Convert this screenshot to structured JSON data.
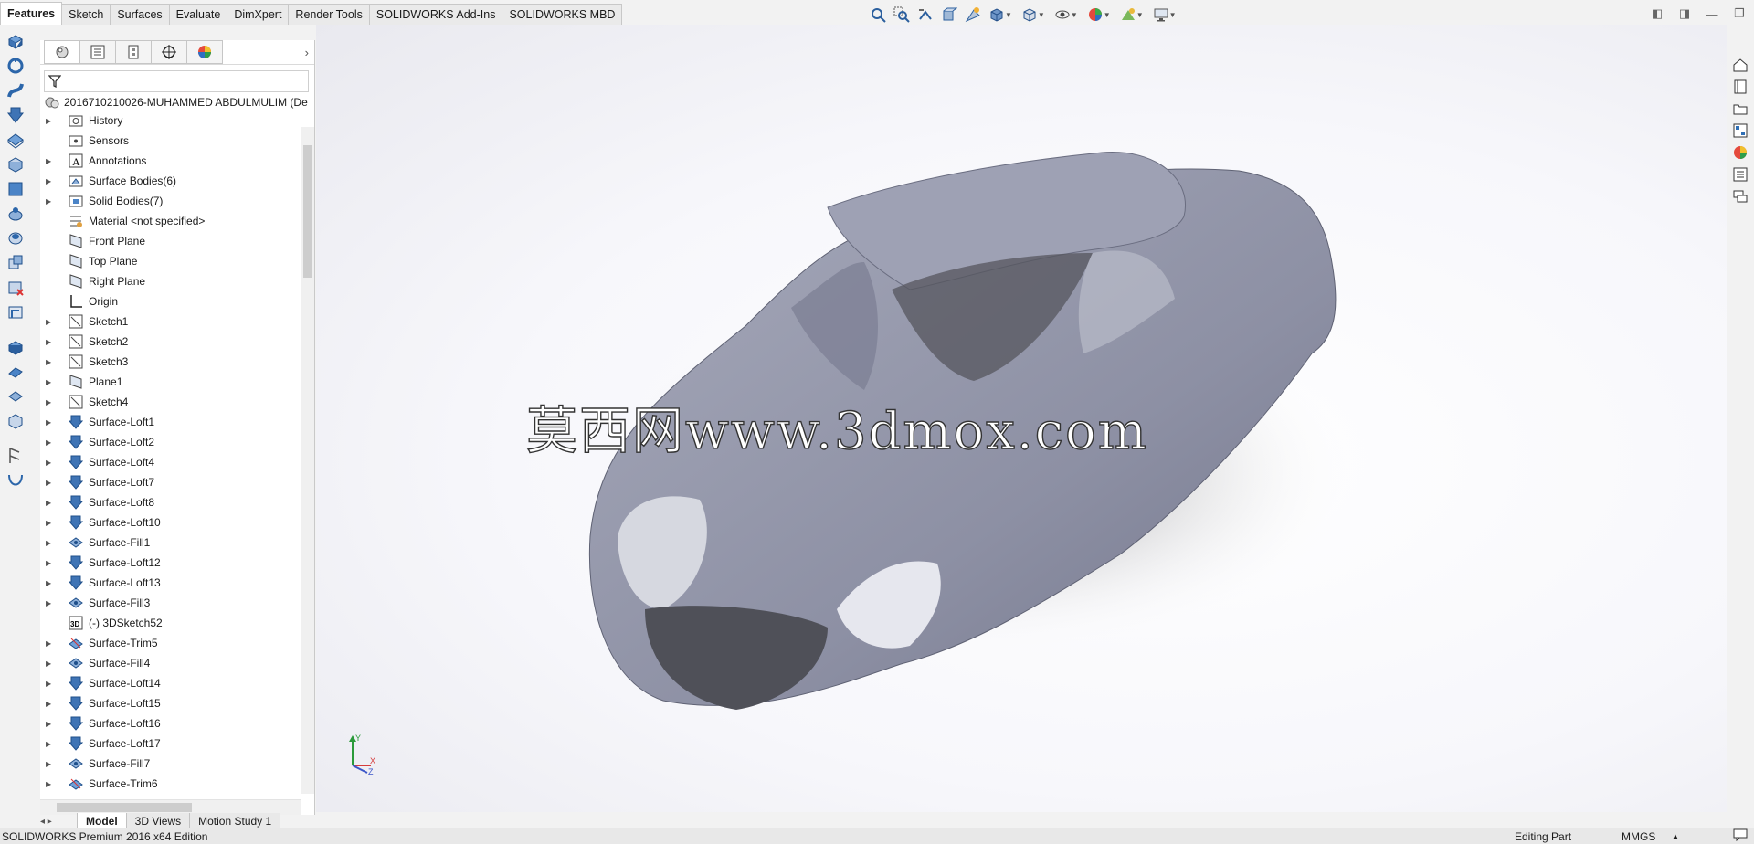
{
  "command_tabs": [
    "Features",
    "Sketch",
    "Surfaces",
    "Evaluate",
    "DimXpert",
    "Render Tools",
    "SOLIDWORKS Add-Ins",
    "SOLIDWORKS MBD"
  ],
  "feature_tree": {
    "root": "2016710210026-MUHAMMED ABDULMULIM  (De",
    "nodes": [
      {
        "label": "History",
        "icon": "history-folder-icon",
        "expandable": true
      },
      {
        "label": "Sensors",
        "icon": "sensors-icon",
        "expandable": false
      },
      {
        "label": "Annotations",
        "icon": "annotations-icon",
        "expandable": true
      },
      {
        "label": "Surface Bodies(6)",
        "icon": "surface-bodies-folder-icon",
        "expandable": true
      },
      {
        "label": "Solid Bodies(7)",
        "icon": "solid-bodies-folder-icon",
        "expandable": true
      },
      {
        "label": "Material <not specified>",
        "icon": "material-icon",
        "expandable": false
      },
      {
        "label": "Front Plane",
        "icon": "plane-icon",
        "expandable": false
      },
      {
        "label": "Top Plane",
        "icon": "plane-icon",
        "expandable": false
      },
      {
        "label": "Right Plane",
        "icon": "plane-icon",
        "expandable": false
      },
      {
        "label": "Origin",
        "icon": "origin-icon",
        "expandable": false
      },
      {
        "label": "Sketch1",
        "icon": "sketch-icon",
        "expandable": true
      },
      {
        "label": "Sketch2",
        "icon": "sketch-icon",
        "expandable": true
      },
      {
        "label": "Sketch3",
        "icon": "sketch-icon",
        "expandable": true
      },
      {
        "label": "Plane1",
        "icon": "plane-icon",
        "expandable": true
      },
      {
        "label": "Sketch4",
        "icon": "sketch-icon",
        "expandable": true
      },
      {
        "label": "Surface-Loft1",
        "icon": "surface-loft-icon",
        "expandable": true
      },
      {
        "label": "Surface-Loft2",
        "icon": "surface-loft-icon",
        "expandable": true
      },
      {
        "label": "Surface-Loft4",
        "icon": "surface-loft-icon",
        "expandable": true
      },
      {
        "label": "Surface-Loft7",
        "icon": "surface-loft-icon",
        "expandable": true
      },
      {
        "label": "Surface-Loft8",
        "icon": "surface-loft-icon",
        "expandable": true
      },
      {
        "label": "Surface-Loft10",
        "icon": "surface-loft-icon",
        "expandable": true
      },
      {
        "label": "Surface-Fill1",
        "icon": "surface-fill-icon",
        "expandable": true
      },
      {
        "label": "Surface-Loft12",
        "icon": "surface-loft-icon",
        "expandable": true
      },
      {
        "label": "Surface-Loft13",
        "icon": "surface-loft-icon",
        "expandable": true
      },
      {
        "label": "Surface-Fill3",
        "icon": "surface-fill-icon",
        "expandable": true
      },
      {
        "label": "(-) 3DSketch52",
        "icon": "3dsketch-icon",
        "expandable": false
      },
      {
        "label": "Surface-Trim5",
        "icon": "surface-trim-icon",
        "expandable": true
      },
      {
        "label": "Surface-Fill4",
        "icon": "surface-fill-icon",
        "expandable": true
      },
      {
        "label": "Surface-Loft14",
        "icon": "surface-loft-icon",
        "expandable": true
      },
      {
        "label": "Surface-Loft15",
        "icon": "surface-loft-icon",
        "expandable": true
      },
      {
        "label": "Surface-Loft16",
        "icon": "surface-loft-icon",
        "expandable": true
      },
      {
        "label": "Surface-Loft17",
        "icon": "surface-loft-icon",
        "expandable": true
      },
      {
        "label": "Surface-Fill7",
        "icon": "surface-fill-icon",
        "expandable": true
      },
      {
        "label": "Surface-Trim6",
        "icon": "surface-trim-icon",
        "expandable": true
      }
    ]
  },
  "viewport": {
    "watermark": "莫西网www.3dmox.com",
    "triad": {
      "x": "X",
      "y": "Y",
      "z": "Z"
    }
  },
  "bottom_tabs": [
    "Model",
    "3D Views",
    "Motion Study 1"
  ],
  "status_bar": {
    "edition": "SOLIDWORKS Premium 2016 x64 Edition",
    "mode": "Editing Part",
    "units": "MMGS"
  },
  "colors": {
    "model": "#8f92a6",
    "accent": "#2f6fb5"
  }
}
